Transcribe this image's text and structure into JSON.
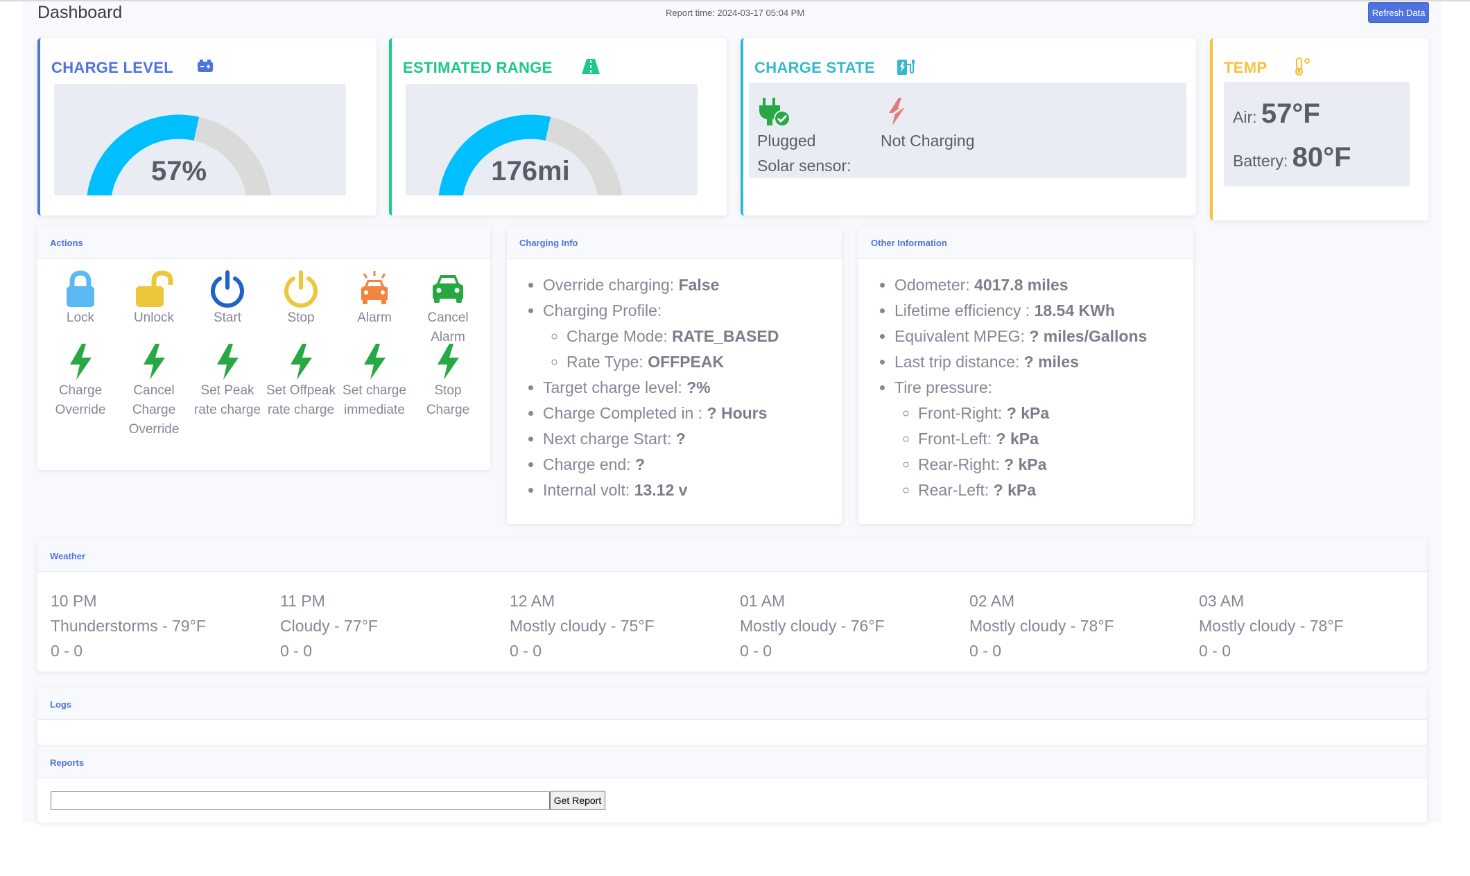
{
  "header": {
    "title": "Dashboard",
    "report_time": "Report time: 2024-03-17 05:04 PM",
    "refresh_label": "Refresh Data"
  },
  "charge_level": {
    "title": "CHARGE LEVEL",
    "value": "57%",
    "percent": 57,
    "color": "#4e73df",
    "icon": "battery-icon"
  },
  "estimated_range": {
    "title": "ESTIMATED RANGE",
    "value": "176mi",
    "percent": 57,
    "color": "#1cc88a",
    "icon": "road-icon"
  },
  "charge_state": {
    "title": "CHARGE STATE",
    "plug_label": "Plugged",
    "charging_label": "Not Charging",
    "solar_label": "Solar sensor:",
    "color": "#36b9cc",
    "icon": "charging-station-icon"
  },
  "temp": {
    "title": "TEMP",
    "air_label": "Air:",
    "air_value": "57°F",
    "battery_label": "Battery:",
    "battery_value": "80°F",
    "color": "#f6c23e",
    "icon": "thermometer-icon"
  },
  "gauge_colors": {
    "fill": "#00bfff",
    "track": "#dadada"
  },
  "actions": {
    "title": "Actions",
    "items": [
      {
        "label": "Lock",
        "icon": "lock-icon",
        "color": "#5bb8f2"
      },
      {
        "label": "Unlock",
        "icon": "unlock-icon",
        "color": "#ecc73c"
      },
      {
        "label": "Start",
        "icon": "power-icon",
        "color": "#1e63c8"
      },
      {
        "label": "Stop",
        "icon": "power-icon",
        "color": "#ecc73c"
      },
      {
        "label": "Alarm",
        "icon": "car-alarm-icon",
        "color": "#f2843d"
      },
      {
        "label": "Cancel Alarm",
        "icon": "car-icon",
        "color": "#28a745"
      },
      {
        "label": "Charge Override",
        "icon": "bolt-icon",
        "color": "#28a745"
      },
      {
        "label": "Cancel Charge Override",
        "icon": "bolt-icon",
        "color": "#28a745"
      },
      {
        "label": "Set Peak rate charge",
        "icon": "bolt-icon",
        "color": "#28a745"
      },
      {
        "label": "Set Offpeak rate charge",
        "icon": "bolt-icon",
        "color": "#28a745"
      },
      {
        "label": "Set charge immediate",
        "icon": "bolt-icon",
        "color": "#28a745"
      },
      {
        "label": "Stop Charge",
        "icon": "bolt-icon",
        "color": "#28a745"
      }
    ]
  },
  "charging_info": {
    "title": "Charging Info",
    "override_label": "Override charging:",
    "override_value": "False",
    "profile_label": "Charging Profile:",
    "mode_label": "Charge Mode:",
    "mode_value": "RATE_BASED",
    "rate_label": "Rate Type:",
    "rate_value": "OFFPEAK",
    "target_label": "Target charge level:",
    "target_value": "?%",
    "completed_label": "Charge Completed in :",
    "completed_value": "? Hours",
    "next_label": "Next charge Start:",
    "next_value": "?",
    "end_label": "Charge end:",
    "end_value": "?",
    "volt_label": "Internal volt:",
    "volt_value": "13.12 v"
  },
  "other_info": {
    "title": "Other Information",
    "odometer_label": "Odometer:",
    "odometer_value": "4017.8 miles",
    "efficiency_label": "Lifetime efficiency :",
    "efficiency_value": "18.54 KWh",
    "mpeg_label": "Equivalent MPEG:",
    "mpeg_value": "? miles/Gallons",
    "trip_label": "Last trip distance:",
    "trip_value": "? miles",
    "tire_label": "Tire pressure:",
    "fr_label": "Front-Right:",
    "fr_value": "? kPa",
    "fl_label": "Front-Left:",
    "fl_value": "? kPa",
    "rr_label": "Rear-Right:",
    "rr_value": "? kPa",
    "rl_label": "Rear-Left:",
    "rl_value": "? kPa"
  },
  "weather": {
    "title": "Weather",
    "hours": [
      {
        "time": "10 PM",
        "desc": "Thunderstorms - 79°F",
        "extra": "0 - 0"
      },
      {
        "time": "11 PM",
        "desc": "Cloudy - 77°F",
        "extra": "0 - 0"
      },
      {
        "time": "12 AM",
        "desc": "Mostly cloudy - 75°F",
        "extra": "0 - 0"
      },
      {
        "time": "01 AM",
        "desc": "Mostly cloudy - 76°F",
        "extra": "0 - 0"
      },
      {
        "time": "02 AM",
        "desc": "Mostly cloudy - 78°F",
        "extra": "0 - 0"
      },
      {
        "time": "03 AM",
        "desc": "Mostly cloudy - 78°F",
        "extra": "0 - 0"
      }
    ]
  },
  "logs": {
    "title": "Logs"
  },
  "reports": {
    "title": "Reports",
    "input_value": "",
    "button_label": "Get Report"
  }
}
